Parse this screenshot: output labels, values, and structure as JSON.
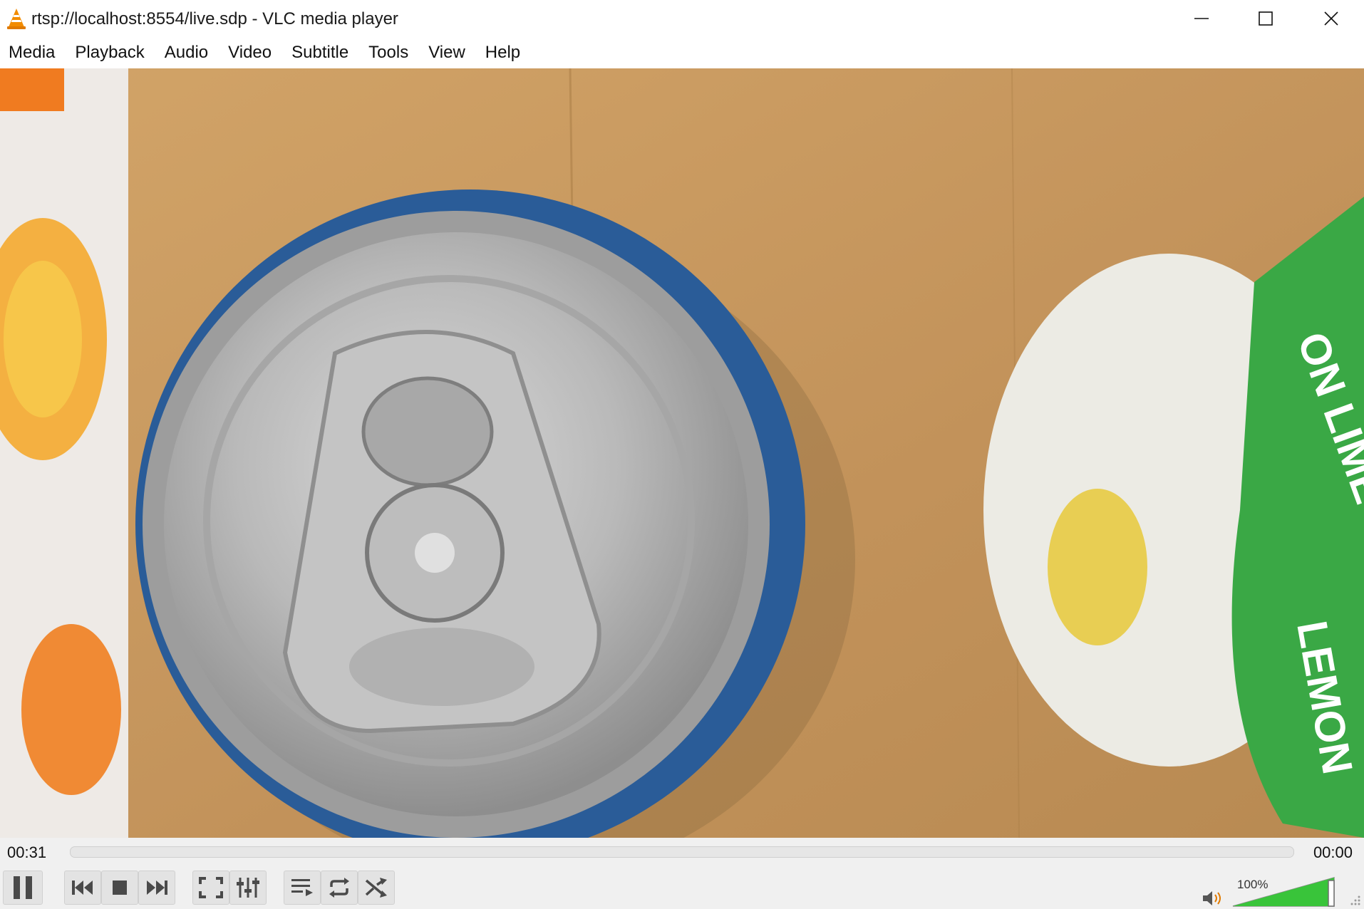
{
  "window": {
    "title": "rtsp://localhost:8554/live.sdp - VLC media player",
    "app_icon": "vlc-cone-icon",
    "controls": [
      "minimize-icon",
      "maximize-icon",
      "close-icon"
    ]
  },
  "menu": {
    "items": [
      "Media",
      "Playback",
      "Audio",
      "Video",
      "Subtitle",
      "Tools",
      "View",
      "Help"
    ]
  },
  "video": {
    "content": "live stream frame"
  },
  "seek": {
    "elapsed": "00:31",
    "total": "00:00",
    "progress": 0
  },
  "controls": {
    "buttons": [
      "pause-icon",
      "previous-icon",
      "stop-icon",
      "next-icon",
      "fullscreen-icon",
      "extended-settings-icon",
      "playlist-icon",
      "loop-icon",
      "shuffle-icon"
    ]
  },
  "volume": {
    "label": "100%",
    "level": 1.0,
    "icon": "speaker-icon",
    "color": "#39c43a"
  }
}
